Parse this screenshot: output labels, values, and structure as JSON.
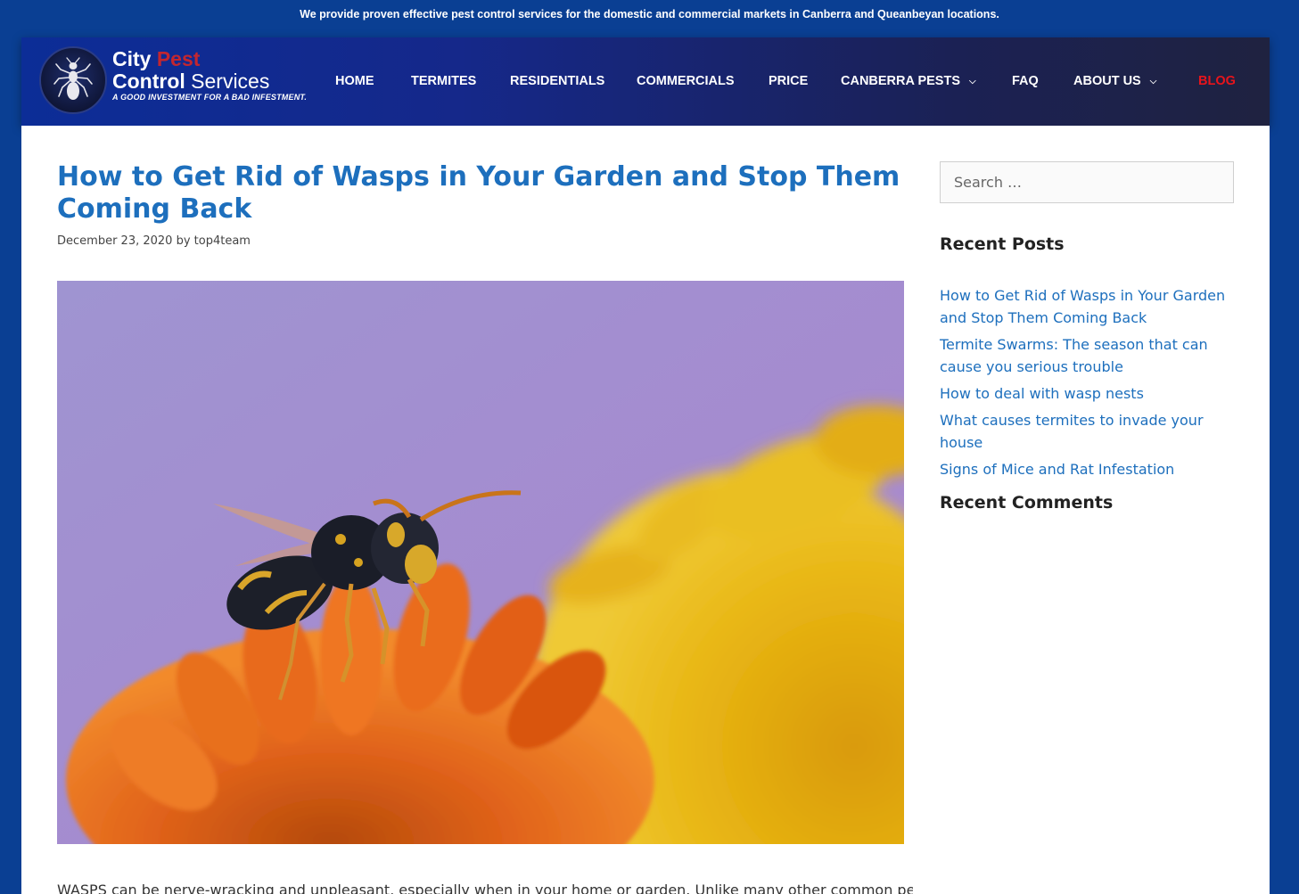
{
  "topbar": {
    "message": "We provide proven effective pest control services for the domestic and commercial markets in Canberra and Queanbeyan locations."
  },
  "brand": {
    "word_city": "City",
    "word_pest": "Pest",
    "word_control": "Control",
    "word_services": "Services",
    "tagline": "A GOOD INVESTMENT FOR A BAD INFESTMENT.",
    "accent_color": "#c3262f"
  },
  "nav": {
    "home": "HOME",
    "termites": "TERMITES",
    "residentials": "RESIDENTIALS",
    "commercials": "COMMERCIALS",
    "price": "PRICE",
    "canberra_pests": "CANBERRA PESTS",
    "faq": "FAQ",
    "about_us": "ABOUT US",
    "blog": "BLOG",
    "active_color": "#e8141b"
  },
  "post": {
    "title": "How to Get Rid of Wasps in Your Garden and Stop Them Coming Back",
    "date": "December 23, 2020",
    "by": "by",
    "author": "top4team",
    "excerpt": "WASPS can be nerve-wracking and unpleasant, especially when in your home or garden. Unlike many other common pests"
  },
  "sidebar": {
    "search_placeholder": "Search …",
    "recent_posts_title": "Recent Posts",
    "recent_posts": [
      "How to Get Rid of Wasps in Your Garden and Stop Them Coming Back",
      "Termite Swarms: The season that can cause you serious trouble",
      "How to deal with wasp nests",
      "What causes termites to invade your house",
      "Signs of Mice and Rat Infestation"
    ],
    "recent_comments_title": "Recent Comments"
  },
  "colors": {
    "page_background": "#0a3f93",
    "link": "#1d6fbd"
  }
}
